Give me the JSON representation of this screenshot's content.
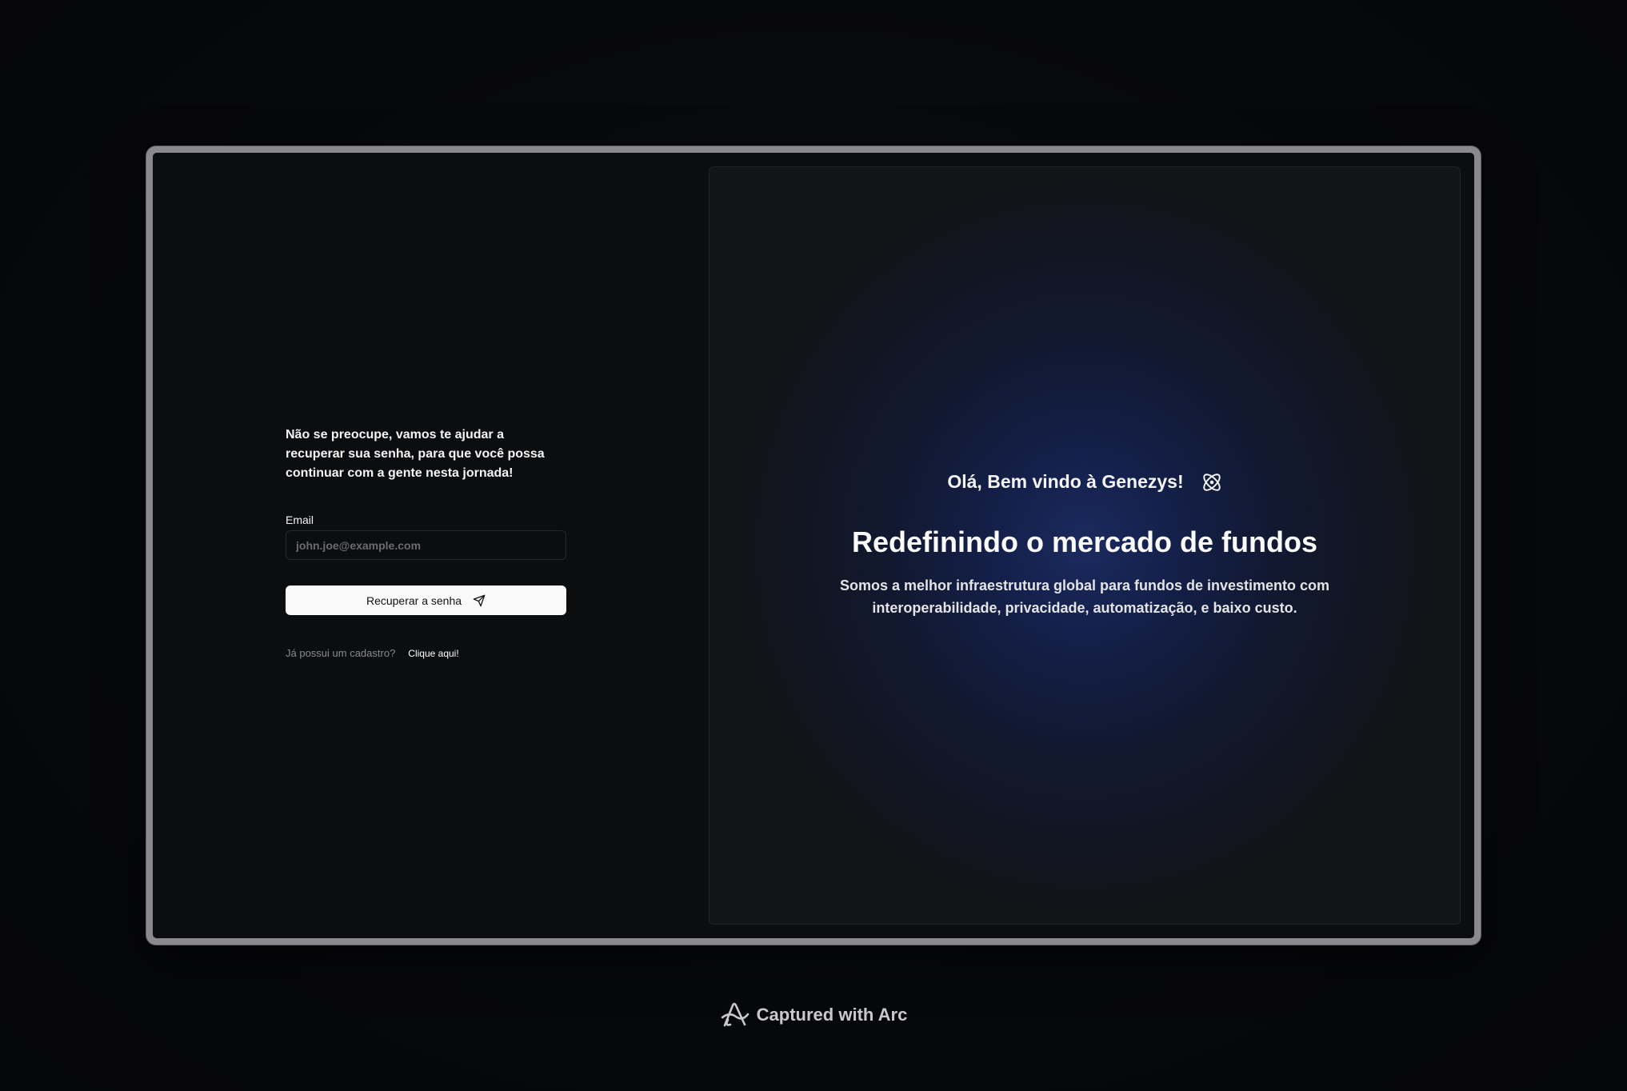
{
  "forgot_password": {
    "intro": "Não se preocupe, vamos te ajudar a recuperar sua senha, para que você possa continuar com a gente nesta jornada!",
    "email_label": "Email",
    "email_placeholder": "john.joe@example.com",
    "email_value": "",
    "submit_label": "Recuperar a senha",
    "submit_icon": "send-icon",
    "login_question": "Já possui um cadastro?",
    "login_link": "Clique aqui!"
  },
  "hero": {
    "welcome": "Olá, Bem vindo à Genezys!",
    "welcome_icon": "atom-icon",
    "title": "Redefinindo o mercado de fundos",
    "subtitle": "Somos a melhor infraestrutura global para fundos de investimento com interoperabilidade, privacidade, automatização, e baixo custo."
  },
  "footer": {
    "capture_label": "Captured with Arc",
    "capture_icon": "arc-icon"
  },
  "colors": {
    "background": "#07080b",
    "panel": "#0c0d0f",
    "accent_glow": "#1b2a5e",
    "button_bg": "#fafafa",
    "frame": "#8a8a8c"
  }
}
